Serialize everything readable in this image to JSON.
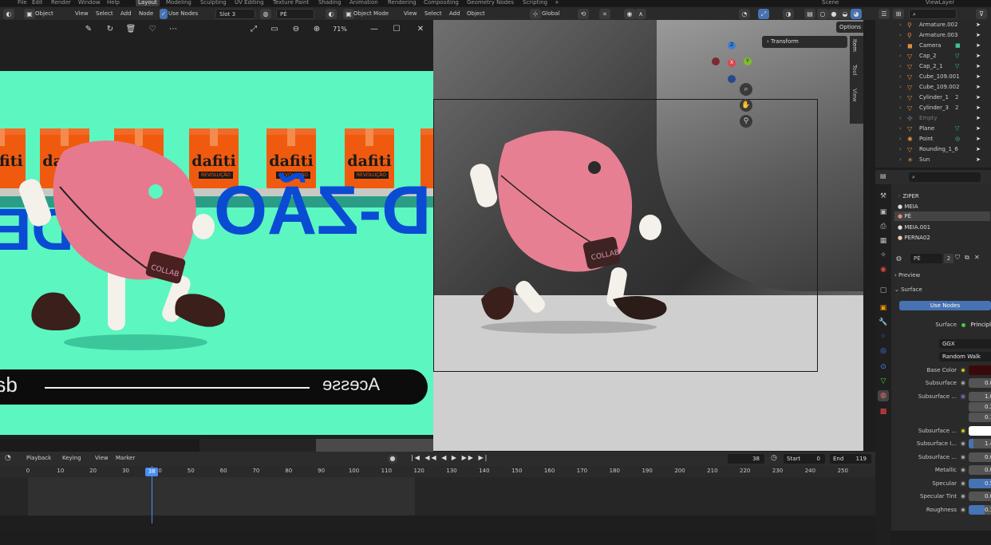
{
  "topbar": {
    "menu": [
      "File",
      "Edit",
      "Render",
      "Window",
      "Help"
    ],
    "workspaces": [
      "Layout",
      "Modeling",
      "Sculpting",
      "UV Editing",
      "Texture Paint",
      "Shading",
      "Animation",
      "Rendering",
      "Compositing",
      "Geometry Nodes",
      "Scripting"
    ],
    "active_workspace": "Layout",
    "add_label": "+",
    "scene": "Scene",
    "view_layer": "ViewLayer"
  },
  "image_editor_header": {
    "mode": "Object",
    "menus": [
      "View",
      "Select",
      "Add",
      "Node"
    ],
    "use_nodes_label": "Use Nodes",
    "use_nodes_checked": true,
    "slot": "Slot 3",
    "material": "PÉ"
  },
  "viewer": {
    "zoom": "71%"
  },
  "ad": {
    "box_logo": "dafiti",
    "box_sub": "REVOLUÇÃO",
    "text_dz": "D-ZÃO",
    "text_de": "DE DE",
    "pill_left": "dafi",
    "pill_right": "Acesse",
    "bag_label": "COLLAB"
  },
  "viewport_header": {
    "mode": "Object Mode",
    "menus": [
      "View",
      "Select",
      "Add",
      "Object"
    ],
    "orientation": "Global",
    "options_label": "Options",
    "transform_label": "Transform",
    "side_tabs": [
      "Item",
      "Tool",
      "View"
    ],
    "gizmo": {
      "x": "X",
      "y": "Y",
      "z": "Z"
    }
  },
  "outliner": {
    "items": [
      {
        "name": "Armature.002",
        "icon": "armature-icon",
        "extra": ""
      },
      {
        "name": "Armature.003",
        "icon": "armature-icon",
        "extra": ""
      },
      {
        "name": "Camera",
        "icon": "camera-icon",
        "extra": "■"
      },
      {
        "name": "Cap_2",
        "icon": "mesh-icon",
        "extra": "▽"
      },
      {
        "name": "Cap_2_1",
        "icon": "mesh-icon",
        "extra": "▽"
      },
      {
        "name": "Cube_109.001",
        "icon": "mesh-icon",
        "extra": ""
      },
      {
        "name": "Cube_109.002",
        "icon": "mesh-icon",
        "extra": ""
      },
      {
        "name": "Cylinder_1",
        "icon": "mesh-icon",
        "extra": "2"
      },
      {
        "name": "Cylinder_3",
        "icon": "mesh-icon",
        "extra": "2"
      },
      {
        "name": "Empty",
        "icon": "empty-icon",
        "extra": ""
      },
      {
        "name": "Plane",
        "icon": "mesh-icon",
        "extra": "▽"
      },
      {
        "name": "Point",
        "icon": "light-icon",
        "extra": "◎"
      },
      {
        "name": "Rounding_1_6",
        "icon": "mesh-icon",
        "extra": ""
      },
      {
        "name": "Sun",
        "icon": "light-icon",
        "extra": ""
      }
    ]
  },
  "materials": {
    "slots": [
      "ZIPER",
      "MEIA",
      "PÉ",
      "MEIA.001",
      "PERNA02"
    ],
    "active": "PÉ",
    "material_name": "PÉ",
    "users": "2",
    "panels": {
      "preview": "Preview",
      "surface": "Surface"
    },
    "use_nodes_button": "Use Nodes",
    "surface_label": "Surface",
    "surface_value": "Principled BSDF",
    "distribution": "GGX",
    "subsurface_method": "Random Walk",
    "base_color_hex": "#3a0a0a",
    "props": [
      {
        "label": "Base Color",
        "value": "",
        "fill": 0,
        "swatch": "#3a0a0a"
      },
      {
        "label": "Subsurface",
        "value": "0.000",
        "fill": 0
      },
      {
        "label": "Subsurface ...",
        "value": "1.000",
        "fill": 0
      },
      {
        "label": "",
        "value": "0.200",
        "fill": 0
      },
      {
        "label": "",
        "value": "0.100",
        "fill": 0
      },
      {
        "label": "Subsurface ...",
        "value": "",
        "fill": 0,
        "swatch": "#ffffff"
      },
      {
        "label": "Subsurface I...",
        "value": "1.400",
        "fill": 0.1
      },
      {
        "label": "Subsurface ...",
        "value": "0.000",
        "fill": 0
      },
      {
        "label": "Metallic",
        "value": "0.000",
        "fill": 0
      },
      {
        "label": "Specular",
        "value": "0.500",
        "fill": 0.5
      },
      {
        "label": "Specular Tint",
        "value": "0.000",
        "fill": 0
      },
      {
        "label": "Roughness",
        "value": "0.341",
        "fill": 0.341
      }
    ]
  },
  "timeline": {
    "menus": [
      "Playback",
      "Keying",
      "View",
      "Marker"
    ],
    "current_frame": "38",
    "start_label": "Start",
    "start": "0",
    "end_label": "End",
    "end": "119",
    "ticks": [
      "0",
      "10",
      "20",
      "30",
      "40",
      "50",
      "60",
      "70",
      "80",
      "90",
      "100",
      "110",
      "120",
      "130",
      "140",
      "150",
      "160",
      "170",
      "180",
      "190",
      "200",
      "210",
      "220",
      "230",
      "240",
      "250"
    ],
    "playhead_frame": 38
  },
  "colors": {
    "accent": "#4772b3",
    "ad_background": "#5cf6c1",
    "ad_blue": "#0a4bd4",
    "box_orange": "#f05a0f",
    "character_pink": "#e6798e"
  }
}
